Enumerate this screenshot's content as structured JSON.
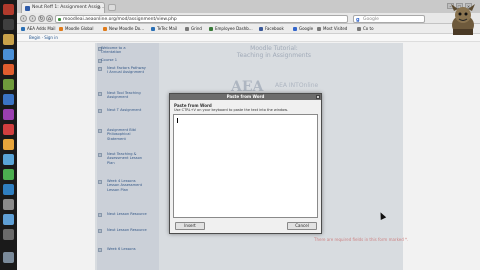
{
  "browser": {
    "tab_title": "Neut Reff 1: Assignment Assig...",
    "url": "moodleai.aeaonline.org/mod/assignment/view.php",
    "search_engine": "Google",
    "search_placeholder": "Google"
  },
  "bookmarks": [
    {
      "label": "AEA Adds Mail",
      "color": "#2a6fb5"
    },
    {
      "label": "Moodle Global",
      "color": "#e07b1a"
    },
    {
      "label": "New Moodle Do...",
      "color": "#e07b1a"
    },
    {
      "label": "TeTec Mail",
      "color": "#2a6fb5"
    },
    {
      "label": "Grind",
      "color": "#7a7a7a"
    },
    {
      "label": "Employee Dashb...",
      "color": "#3a7a3a"
    },
    {
      "label": "Facebook",
      "color": "#3b5998"
    },
    {
      "label": "Google",
      "color": "#3366cc"
    },
    {
      "label": "Most Visited",
      "color": "#7a7a7a"
    },
    {
      "label": "Co to",
      "color": "#7a7a7a"
    }
  ],
  "site_nav": {
    "login_label": "Begin · Sign in"
  },
  "page": {
    "nav_links": [
      "Welcome to a Orientation",
      "Course 1",
      "Neut Factors Pathway I Annual Assignment",
      "Neut Tool Teaching Assignment",
      "Neut T Assignment",
      "Assignment Bibl Philosophical Statement",
      "Neut Teaching & Assessment Lesson Plan",
      "Week 4 Lessons Lesson Assessment Lesson Plan",
      "Neut Lesson Resource",
      "Neut Lesson Resource",
      "Week 6 Lessons"
    ],
    "header_lines": [
      "Moodle Tutorial:",
      "Teaching in Assignments"
    ],
    "logo_text": "AEA",
    "logo_sub": "AEA INTOnline",
    "required_note": "There are required fields in this form marked *."
  },
  "dialog": {
    "title": "Paste from Word",
    "heading": "Paste from Word",
    "instruction": "Use CTRL+V on your keyboard to paste the text into the window.",
    "textarea_value": "",
    "insert_label": "Insert",
    "cancel_label": "Cancel"
  },
  "colors": {
    "dialog_titlebar": "#6c6c6c",
    "page_left_column": "#d6dce4",
    "link": "#365b8e"
  }
}
